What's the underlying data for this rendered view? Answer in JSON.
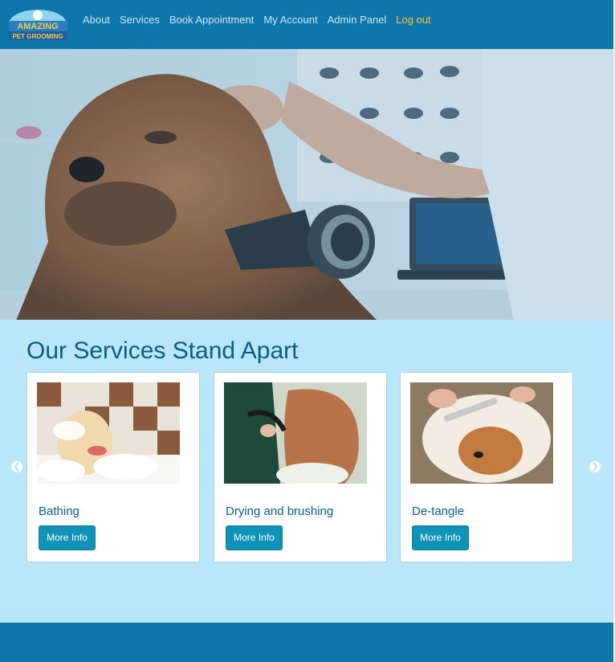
{
  "brand": {
    "logo_line1": "AMAZING",
    "logo_line2": "PET GROOMING"
  },
  "nav": {
    "items": [
      {
        "label": "About"
      },
      {
        "label": "Services"
      },
      {
        "label": "Book Appointment"
      },
      {
        "label": "My Account"
      },
      {
        "label": "Admin Panel"
      },
      {
        "label": "Log out"
      }
    ]
  },
  "services": {
    "title": "Our Services Stand Apart",
    "cards": [
      {
        "title": "Bathing",
        "button": "More Info"
      },
      {
        "title": "Drying and brushing",
        "button": "More Info"
      },
      {
        "title": "De-tangle",
        "button": "More Info"
      }
    ],
    "prev_icon": "chevron-left-icon",
    "next_icon": "chevron-right-icon"
  },
  "colors": {
    "navbar": "#0e76a8",
    "services_bg": "#b9e6f8",
    "title": "#0b5d87",
    "button": "#0f93b8",
    "logout": "#f4c542"
  }
}
